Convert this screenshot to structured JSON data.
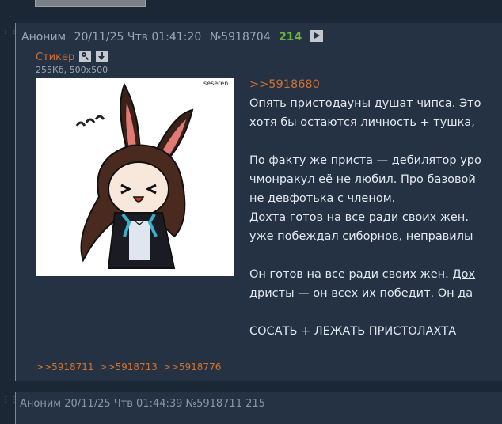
{
  "previous_post": {},
  "post": {
    "author": "Аноним",
    "date": "20/11/25 Чтв 01:41:20",
    "number": "№5918704",
    "reply_count": "214",
    "file": {
      "name": "Стикер",
      "meta": "255Кб, 500x500",
      "watermark": "seseren"
    },
    "reply_to": ">>5918680",
    "lines": [
      "Опять пристодауны душат чипса. Это",
      "хотя бы остаются личность + тушка,",
      "",
      "По факту же приста — дебилятор уро",
      "чмонракул её не любил. Про базовой",
      "не девфотька с членом.",
      "Дохта готов на все ради своих жен.",
      "уже побеждал сиборнов, неправилы",
      "",
      "Он готов на все ради своих жен.",
      "дристы — он всех их победит. Он да",
      "",
      "СОСАТЬ + ЛЕЖАТЬ ПРИСТОЛАХТА"
    ],
    "line10_link": "Дох",
    "replies": [
      ">>5918711",
      ">>5918713",
      ">>5918776"
    ]
  },
  "next_post": {
    "header_partial": "Аноним 20/11/25 Чтв 01:44:39 №5918711 215"
  },
  "colors": {
    "background": "#1c2735",
    "post_bg": "#253243",
    "accent": "#d0712f",
    "count": "#6ab43c",
    "text": "#e2e8ef"
  }
}
